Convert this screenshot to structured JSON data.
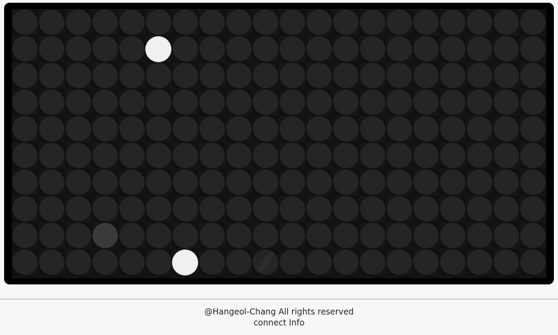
{
  "board": {
    "cols": 20,
    "rows": 10,
    "cell_color": "#252525",
    "highlight_color": "#3a3a3a",
    "piece_color": "#f0f0f0",
    "pieces": [
      {
        "col": 5,
        "row": 1
      },
      {
        "col": 6,
        "row": 9
      }
    ],
    "highlighted_cells": [
      {
        "col": 3,
        "row": 8
      }
    ],
    "marks": [
      {
        "col": 9,
        "row": 9,
        "icon": "slash-mark"
      }
    ]
  },
  "footer": {
    "copyright": "@Hangeol-Chang All rights reserved",
    "link": "connect Info"
  }
}
